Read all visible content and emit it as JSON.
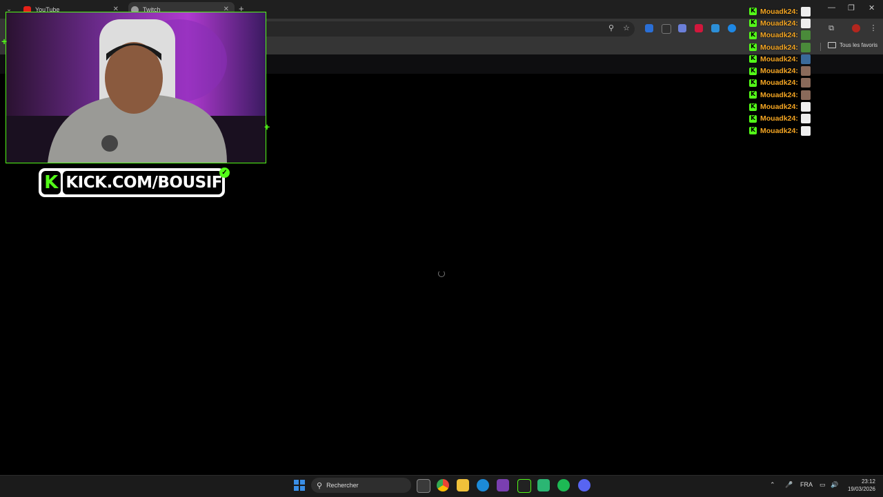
{
  "browser": {
    "tabs": [
      {
        "label": "YouTube",
        "icon": "youtube-icon"
      },
      {
        "label": "Twitch",
        "icon": "twitch-icon",
        "active": true
      }
    ],
    "bookmarks_folder": "Tous les favoris"
  },
  "overlay": {
    "channel_banner": "KICK.COM/BOUSIF",
    "brand_color": "#53fc18",
    "chat": {
      "messages": [
        {
          "user": "Mouadk24:"
        },
        {
          "user": "Mouadk24:"
        },
        {
          "user": "Mouadk24:"
        },
        {
          "user": "Mouadk24:"
        },
        {
          "user": "Mouadk24:"
        },
        {
          "user": "Mouadk24:"
        },
        {
          "user": "Mouadk24:"
        },
        {
          "user": "Mouadk24:"
        },
        {
          "user": "Mouadk24:"
        },
        {
          "user": "Mouadk24:"
        },
        {
          "user": "Mouadk24:"
        }
      ],
      "username_color": "#f5a623"
    }
  },
  "taskbar": {
    "search_placeholder": "Rechercher",
    "language": "FRA",
    "time": "23:12",
    "date": "19/03/2026"
  }
}
